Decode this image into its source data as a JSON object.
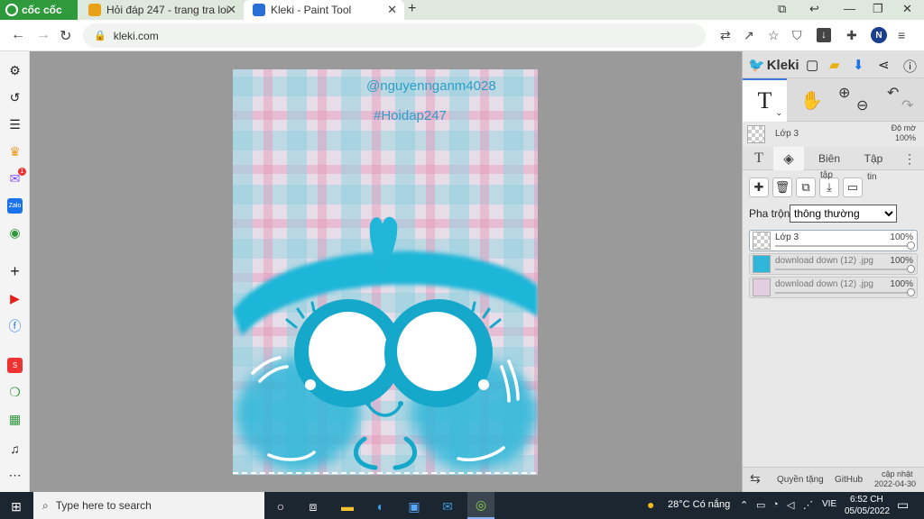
{
  "browser": {
    "brand": "cốc cốc",
    "tabs": [
      {
        "title": "Hỏi đáp 247 - trang tra loi",
        "active": false
      },
      {
        "title": "Kleki - Paint Tool",
        "active": true
      }
    ],
    "address": "kleki.com",
    "profile_initial": "N",
    "notification_badge": "1"
  },
  "canvas": {
    "watermark_user": "@nguyennganm4028",
    "watermark_tag": "#Hoidap247",
    "background_color": "#9a9a9a",
    "accent_color": "#1fb6d8"
  },
  "kleki": {
    "title": "Kleki",
    "tool_glyph": "T",
    "opacity_label": "Độ mờ",
    "opacity_value": "100%",
    "current_layer": "Lớp 3",
    "tabs": [
      "Biên",
      "Tập"
    ],
    "button_labels": {
      "merge": "tập",
      "info": "tin"
    },
    "blend_label": "Pha trộn",
    "blend_mode": "thông thường",
    "layers": [
      {
        "name": "Lớp 3",
        "opacity": "100%",
        "active": true
      },
      {
        "name": "download down (12) .jpg",
        "opacity": "100%",
        "active": false
      },
      {
        "name": "download down (12) .jpg",
        "opacity": "100%",
        "active": false
      }
    ],
    "footer": {
      "privacy": "Quyền tặng",
      "github": "GitHub",
      "updated_label": "cập nhật",
      "updated_date": "2022-04-30"
    }
  },
  "taskbar": {
    "search_placeholder": "Type here to search",
    "weather": "28°C Có nắng",
    "language": "VIE",
    "time": "6:52 CH",
    "date": "05/05/2022"
  }
}
